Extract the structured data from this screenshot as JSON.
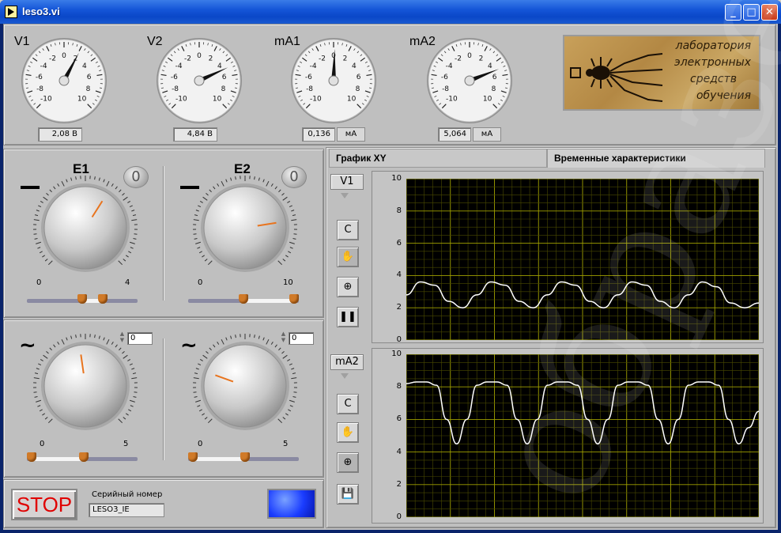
{
  "window": {
    "title": "leso3.vi",
    "minimize_icon": "minimize-icon",
    "maximize_icon": "maximize-icon",
    "close_icon": "close-icon"
  },
  "meters": [
    {
      "label": "V1",
      "readout": "2,08 B",
      "unit": "",
      "value": 2.08
    },
    {
      "label": "V2",
      "readout": "4,84 B",
      "unit": "",
      "value": 4.84
    },
    {
      "label": "mA1",
      "readout": "0,136",
      "unit": "мА",
      "value": 0.136
    },
    {
      "label": "mA2",
      "readout": "5,064",
      "unit": "мА",
      "value": 5.064
    }
  ],
  "meter_scale": [
    "-10",
    "-8",
    "-6",
    "-4",
    "-2",
    "0",
    "2",
    "4",
    "6",
    "8",
    "10"
  ],
  "logo": {
    "lines": [
      "лаборатория",
      "электронных",
      "средств",
      "обучения"
    ]
  },
  "knobs": {
    "e1": {
      "title": "E1",
      "zero": "0",
      "min": "0",
      "max": "4",
      "symbol": "dc"
    },
    "e2": {
      "title": "E2",
      "zero": "0",
      "min": "0",
      "max": "10",
      "symbol": "dc"
    },
    "ac1": {
      "min": "0",
      "max": "5",
      "input": "0",
      "symbol": "ac"
    },
    "ac2": {
      "min": "0",
      "max": "5",
      "input": "0",
      "symbol": "ac"
    }
  },
  "bottom": {
    "stop_label": "STOP",
    "serial_label": "Серийный номер",
    "serial_value": "LESO3_IE"
  },
  "tabs": [
    {
      "label": "График XY",
      "active": false
    },
    {
      "label": "Временные характеристики",
      "active": true
    }
  ],
  "graph_controls": {
    "channel1": "V1",
    "channel2": "mA2",
    "clear_label": "C",
    "hand_icon": "hand-icon",
    "zoom_icon": "zoom-icon",
    "pause_icon": "pause-icon",
    "save_icon": "save-icon"
  },
  "chart_data": [
    {
      "type": "line",
      "title": "",
      "xlabel": "",
      "ylabel": "",
      "ylim": [
        0,
        10
      ],
      "yticks": [
        "10",
        "8",
        "6",
        "4",
        "2",
        "0"
      ],
      "grid": true,
      "series": [
        {
          "values": [
            2.8,
            3.6,
            3.4,
            2.4,
            2.0,
            2.8,
            3.6,
            3.4,
            2.4,
            2.0,
            2.8,
            3.6,
            3.4,
            2.4,
            2.0,
            2.8,
            3.6,
            3.4,
            2.4,
            2.0,
            2.8,
            3.6,
            3.3,
            2.3,
            2.0,
            2.3
          ]
        }
      ]
    },
    {
      "type": "line",
      "title": "",
      "xlabel": "",
      "ylabel": "",
      "ylim": [
        0,
        10
      ],
      "yticks": [
        "10",
        "8",
        "6",
        "4",
        "2",
        "0"
      ],
      "grid": true,
      "series": [
        {
          "values": [
            8.2,
            8.3,
            8.3,
            8.1,
            6.0,
            4.5,
            6.0,
            8.1,
            8.3,
            8.3,
            8.1,
            6.0,
            4.5,
            6.0,
            8.1,
            8.3,
            8.3,
            8.1,
            6.0,
            4.5,
            6.0,
            8.1,
            8.3,
            8.3,
            8.1,
            6.0,
            4.5,
            6.0,
            8.1,
            8.3,
            8.3,
            8.1,
            6.0,
            4.5,
            5.5,
            6.5
          ]
        }
      ]
    }
  ],
  "watermark": "образец"
}
